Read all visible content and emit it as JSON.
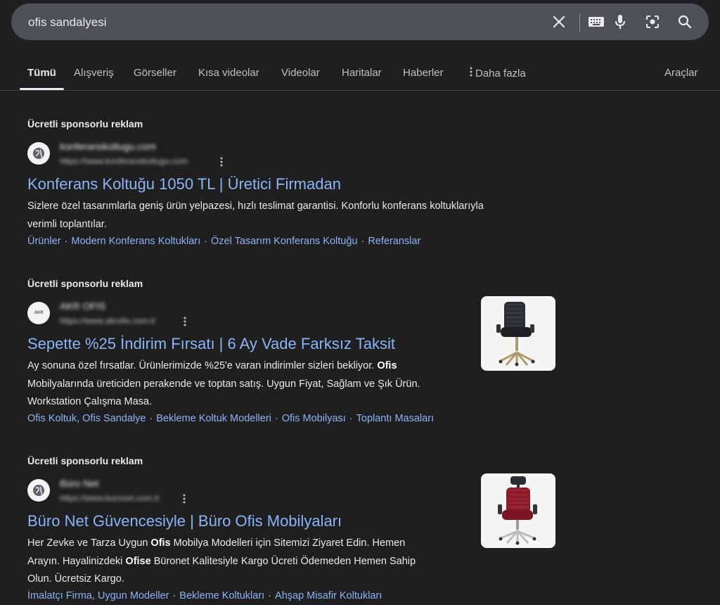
{
  "search": {
    "query": "ofis sandalyesi",
    "clear_icon": "close-icon",
    "keyboard_icon": "keyboard-icon",
    "voice_icon": "microphone-icon",
    "lens_icon": "lens-icon",
    "search_icon": "search-icon"
  },
  "tabs": {
    "items": [
      "Tümü",
      "Alışveriş",
      "Görseller",
      "Kısa videolar",
      "Videolar",
      "Haritalar",
      "Haberler"
    ],
    "more_label": "Daha fazla",
    "tools_label": "Araçlar"
  },
  "ads": [
    {
      "label": "Ücretli sponsorlu reklam",
      "site_name": "konferanskoltugu.com",
      "site_url": "https://www.konferanskoltugu.com",
      "title": "Konferans Koltuğu 1050 TL | Üretici Firmadan",
      "desc_line1": "Sizlere özel tasarımlarla geniş ürün yelpazesi, hızlı teslimat garantisi. Konforlu konferans koltuklarıyla",
      "desc_line2": "verimli toplantılar.",
      "sitelinks": [
        "Ürünler",
        "Modern Konferans Koltukları",
        "Özel Tasarım Konferans Koltuğu",
        "Referanslar"
      ]
    },
    {
      "label": "Ücretli sponsorlu reklam",
      "site_name": "AKR OFIS",
      "site_url": "https://www.akrofis.com.tr",
      "favicon_text": "AKR",
      "title": "Sepette %25 İndirim Fırsatı | 6 Ay Vade Farksız Taksit",
      "desc_line1_a": "Ay sonuna özel fırsatlar. Ürünlerimizde %25'e varan indirimler sizleri bekliyor. ",
      "desc_line1_b": "Ofis",
      "desc_line2": "Mobilyalarında üreticiden perakende ve toptan satış. Uygun Fiyat, Sağlam ve Şık Ürün.",
      "desc_line3": "Workstation Çalışma Masa.",
      "sitelinks": [
        "Ofis Koltuk, Ofis Sandalye",
        "Bekleme Koltuk Modelleri",
        "Ofis Mobilyası",
        "Toplantı Masaları"
      ]
    },
    {
      "label": "Ücretli sponsorlu reklam",
      "site_name": "Büro Net",
      "site_url": "https://www.buronet.com.tr",
      "title": "Büro Net Güvencesiyle | Büro Ofis Mobilyaları",
      "desc_line1_a": "Her Zevke ve Tarza Uygun ",
      "desc_line1_b": "Ofis",
      "desc_line1_c": " Mobilya Modelleri için Sitemizi Ziyaret Edin. Hemen",
      "desc_line2_a": "Arayın. Hayalinizdeki ",
      "desc_line2_b": "Ofise",
      "desc_line2_c": " Büronet Kalitesiyle Kargo Ücreti Ödemeden Hemen Sahip",
      "desc_line3": "Olun. Ücretsiz Kargo.",
      "sitelinks": [
        "İmalatçı Firma, Uygun Modeller",
        "Bekleme Koltukları",
        "Ahşap Misafir Koltukları"
      ]
    }
  ],
  "colors": {
    "background": "#1f1f1f",
    "searchbox": "#4d5156",
    "link": "#8ab4f8",
    "chair_mesh_black": "#2b2e33",
    "chair_mesh_red": "#8e1b2a"
  }
}
